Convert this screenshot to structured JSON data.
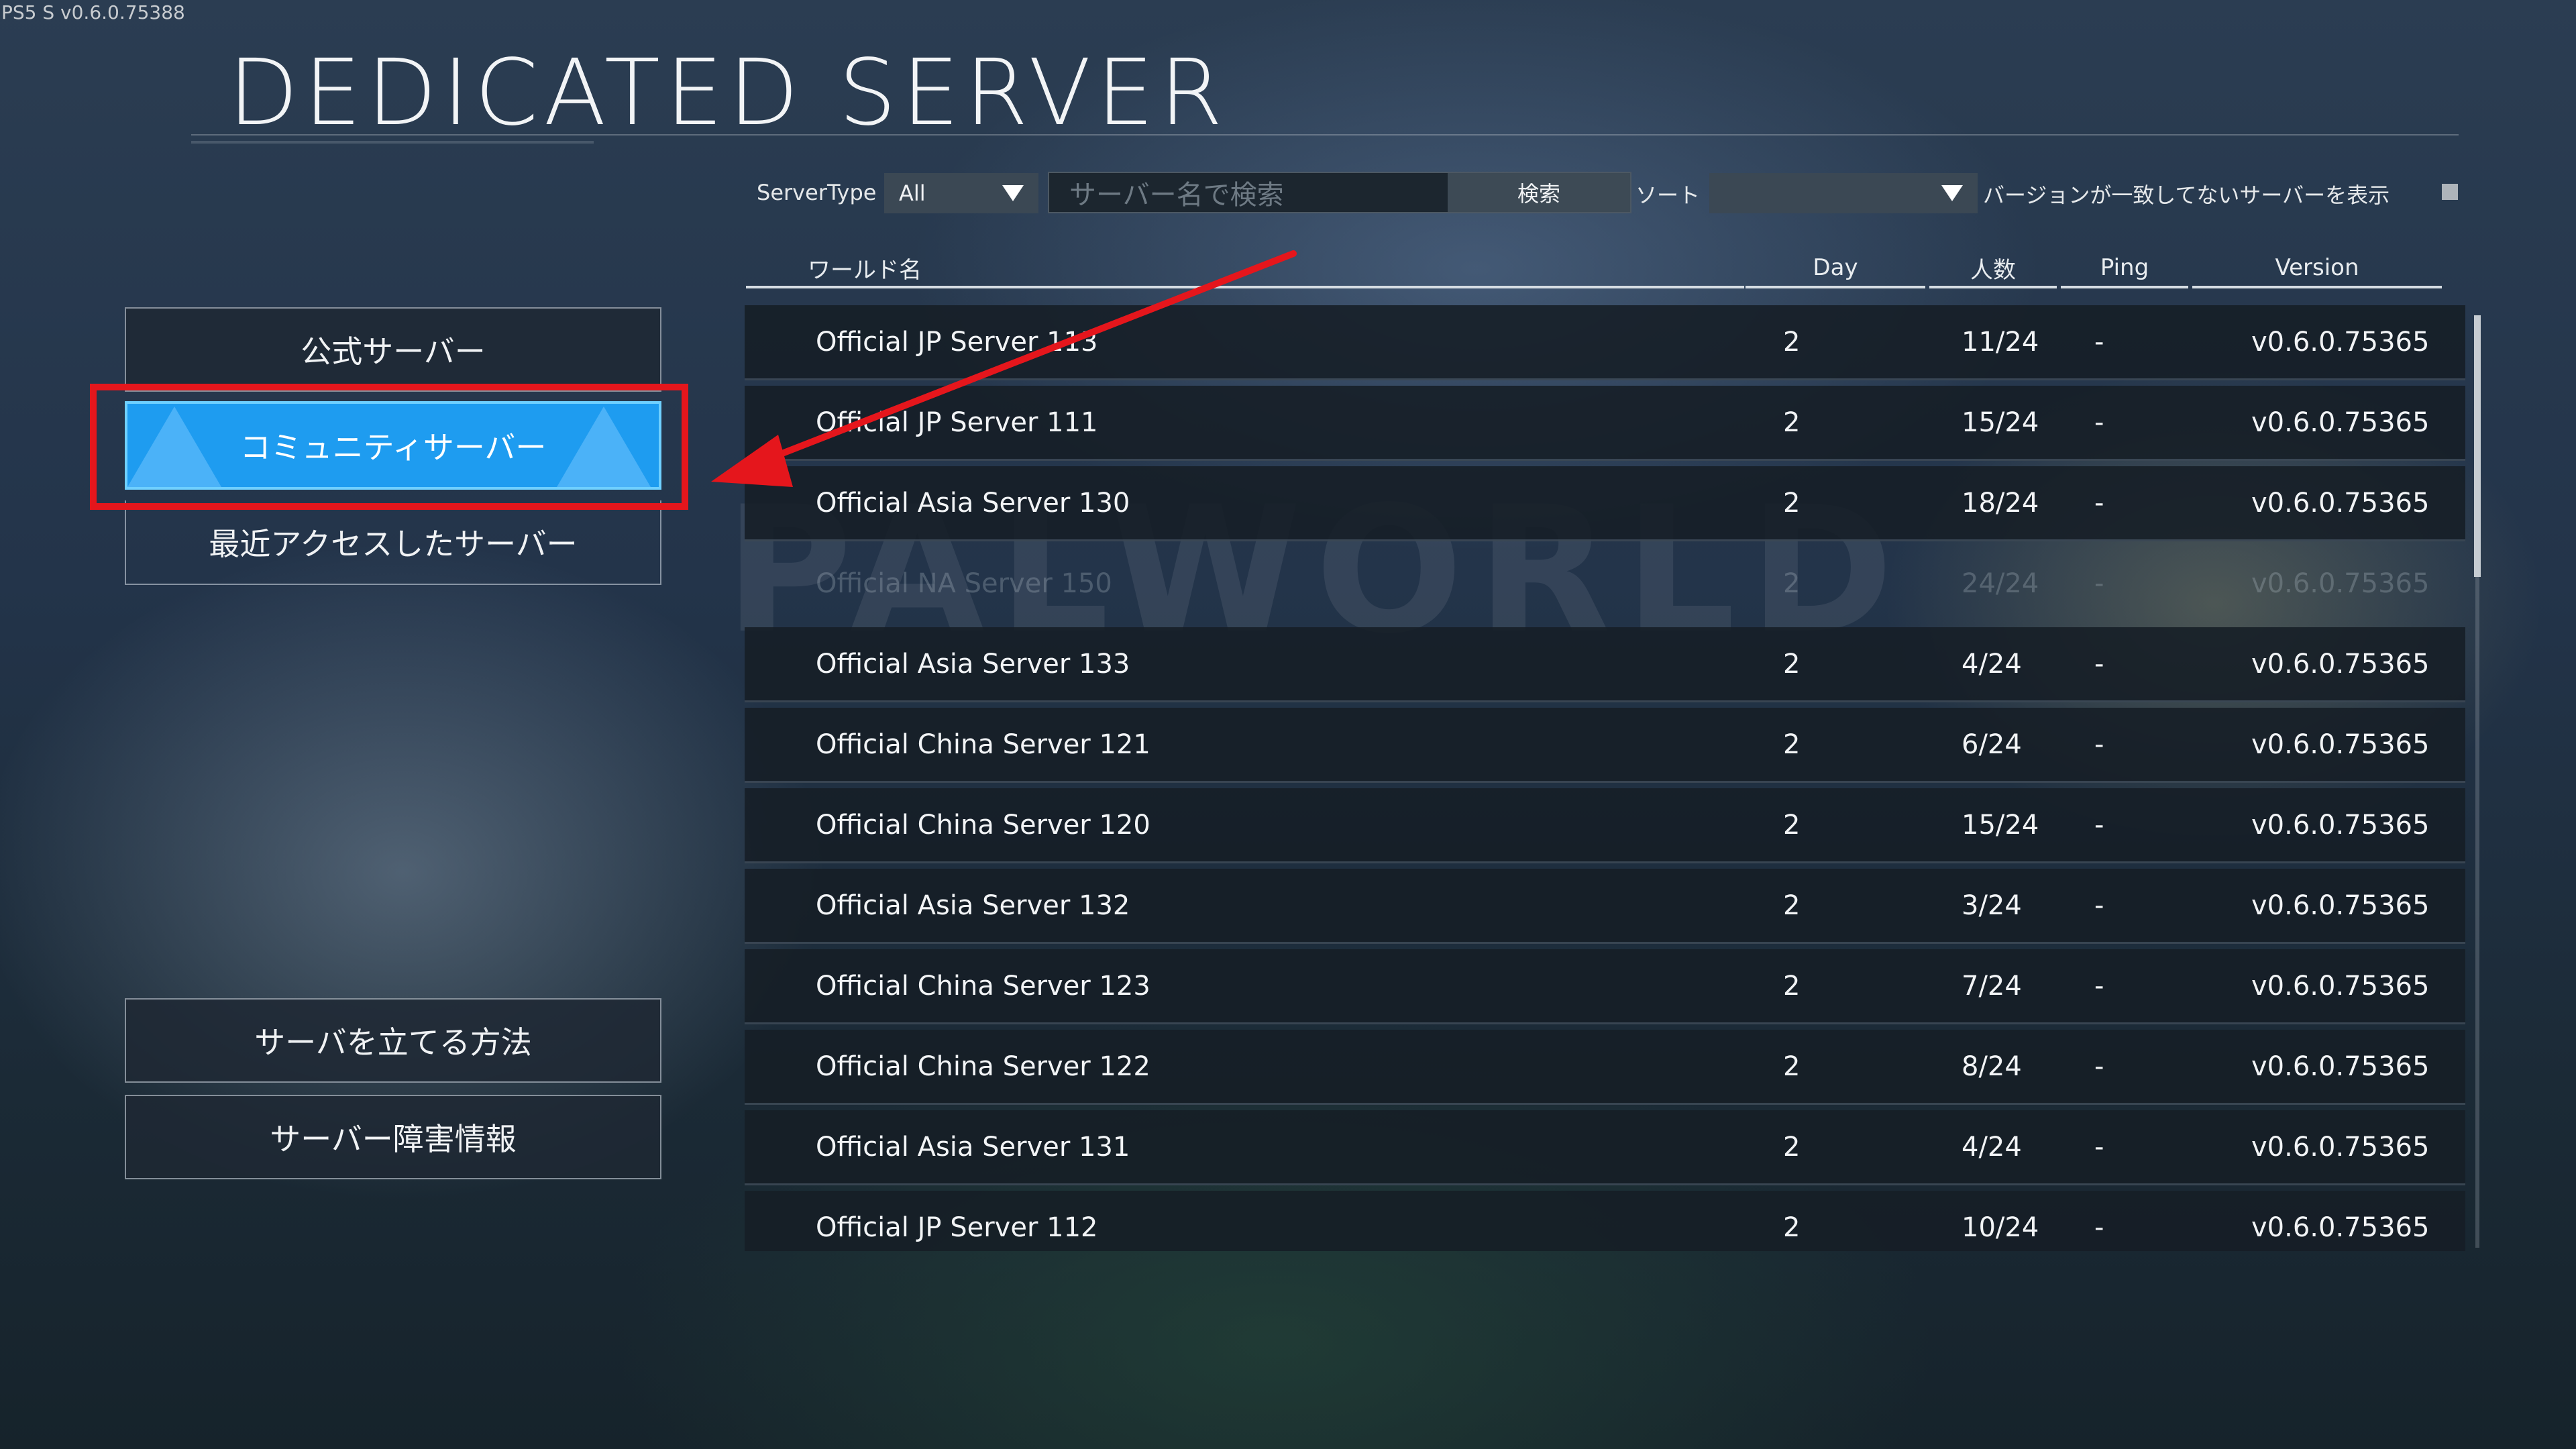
{
  "build_version": "PS5 S v0.6.0.75388",
  "title": "DEDICATED SERVER",
  "watermark": "PALWORLD",
  "menu": {
    "official": "公式サーバー",
    "community": "コミュニティサーバー",
    "recent": "最近アクセスしたサーバー",
    "howto": "サーバを立てる方法",
    "status": "サーバー障害情報"
  },
  "filters": {
    "server_type_label": "ServerType",
    "server_type_value": "All",
    "search_placeholder": "サーバー名で検索",
    "search_button": "検索",
    "sort_label": "ソート",
    "sort_value": "",
    "mismatch_label": "バージョンが一致してないサーバーを表示"
  },
  "table": {
    "headers": {
      "name": "ワールド名",
      "day": "Day",
      "players": "人数",
      "ping": "Ping",
      "version": "Version"
    },
    "rows": [
      {
        "name": "Official JP Server 113",
        "day": "2",
        "players": "11/24",
        "ping": "-",
        "version": "v0.6.0.75365"
      },
      {
        "name": "Official JP Server 111",
        "day": "2",
        "players": "15/24",
        "ping": "-",
        "version": "v0.6.0.75365"
      },
      {
        "name": "Official Asia Server 130",
        "day": "2",
        "players": "18/24",
        "ping": "-",
        "version": "v0.6.0.75365"
      },
      {
        "name": "Official NA Server 150",
        "day": "2",
        "players": "24/24",
        "ping": "-",
        "version": "v0.6.0.75365"
      },
      {
        "name": "Official Asia Server 133",
        "day": "2",
        "players": "4/24",
        "ping": "-",
        "version": "v0.6.0.75365"
      },
      {
        "name": "Official China Server 121",
        "day": "2",
        "players": "6/24",
        "ping": "-",
        "version": "v0.6.0.75365"
      },
      {
        "name": "Official China Server 120",
        "day": "2",
        "players": "15/24",
        "ping": "-",
        "version": "v0.6.0.75365"
      },
      {
        "name": "Official Asia Server 132",
        "day": "2",
        "players": "3/24",
        "ping": "-",
        "version": "v0.6.0.75365"
      },
      {
        "name": "Official China Server 123",
        "day": "2",
        "players": "7/24",
        "ping": "-",
        "version": "v0.6.0.75365"
      },
      {
        "name": "Official China Server 122",
        "day": "2",
        "players": "8/24",
        "ping": "-",
        "version": "v0.6.0.75365"
      },
      {
        "name": "Official Asia Server 131",
        "day": "2",
        "players": "4/24",
        "ping": "-",
        "version": "v0.6.0.75365"
      },
      {
        "name": "Official JP Server 112",
        "day": "2",
        "players": "10/24",
        "ping": "-",
        "version": "v0.6.0.75365"
      }
    ]
  },
  "colors": {
    "active_button": "#1e9cf0",
    "annotation": "#e5161c"
  }
}
